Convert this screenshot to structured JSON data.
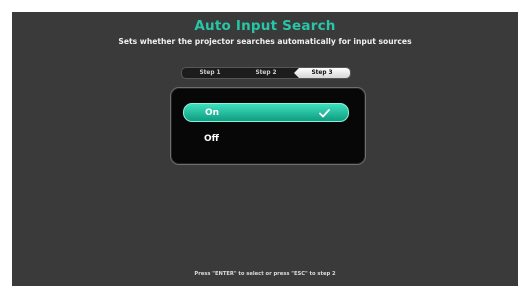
{
  "header": {
    "title": "Auto Input Search",
    "subtitle": "Sets whether the projector searches automatically for input sources"
  },
  "steps": [
    {
      "label": "Step 1",
      "active": false
    },
    {
      "label": "Step 2",
      "active": false
    },
    {
      "label": "Step 3",
      "active": true
    }
  ],
  "options": [
    {
      "label": "On",
      "selected": true
    },
    {
      "label": "Off",
      "selected": false
    }
  ],
  "footer": {
    "hint": "Press \"ENTER\" to select or press \"ESC\" to step 2"
  },
  "colors": {
    "accent": "#27c6a6",
    "selected_fill": "#1fb894",
    "background": "#3a3a3a",
    "panel": "#070707"
  }
}
